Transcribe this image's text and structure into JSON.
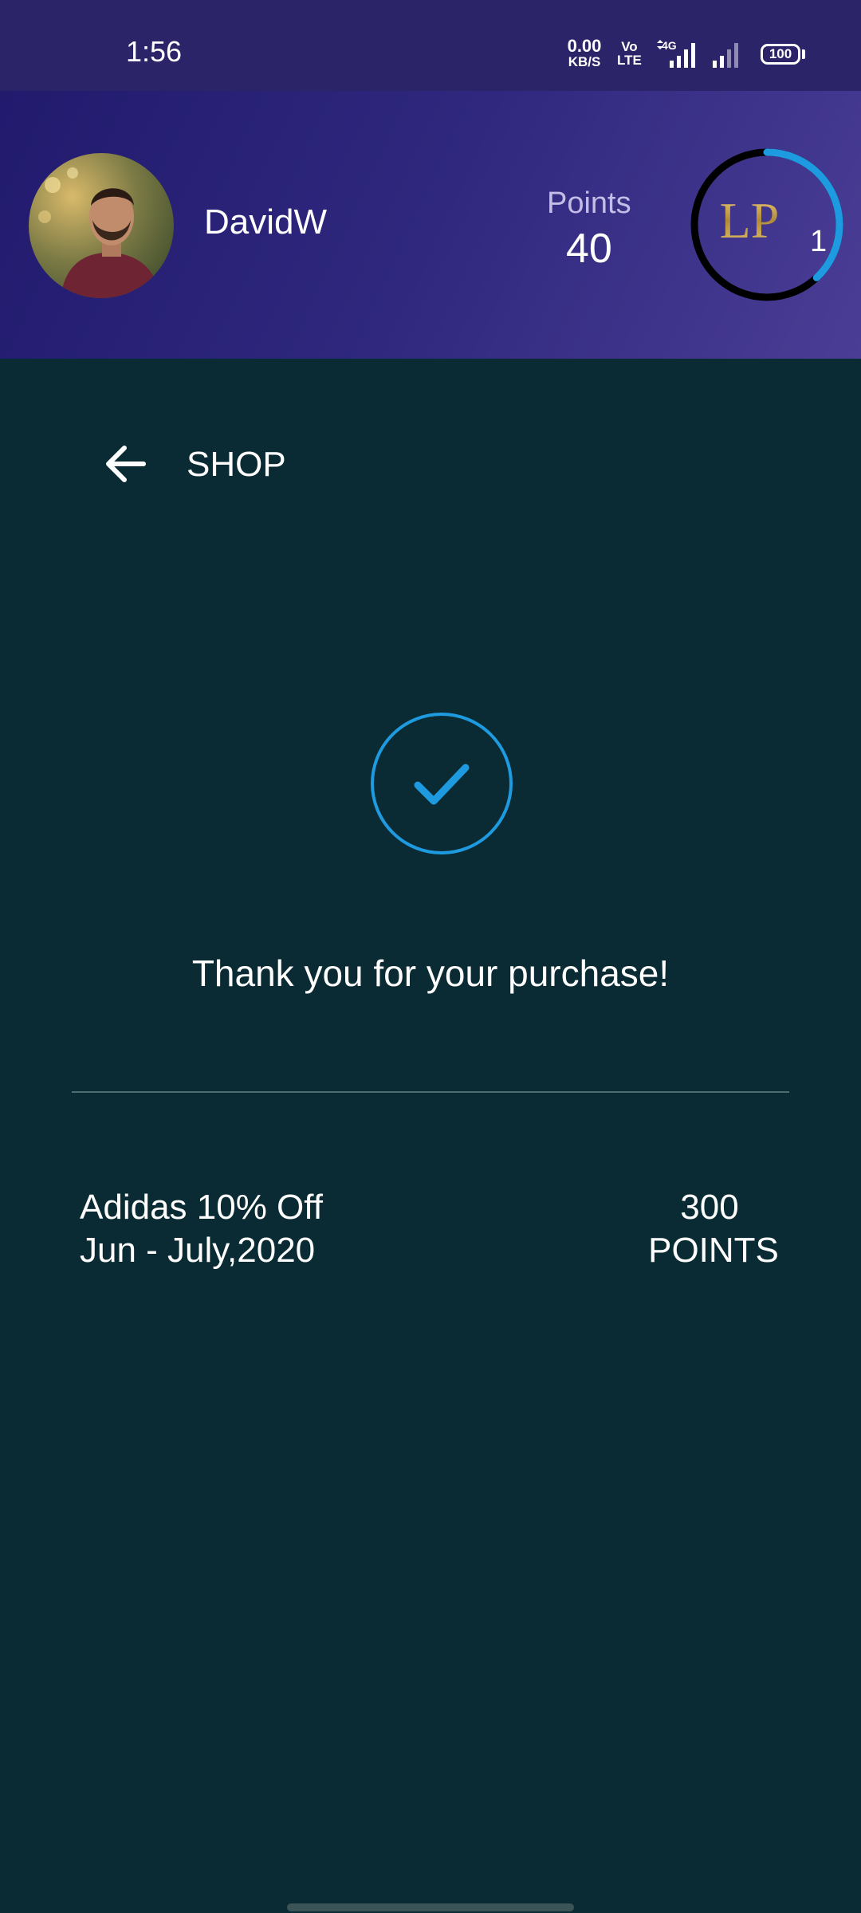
{
  "status_bar": {
    "time": "1:56",
    "net_speed": "0.00",
    "net_speed_unit": "KB/S",
    "volte_top": "Vo",
    "volte_bottom": "LTE",
    "network": "4G",
    "battery": "100"
  },
  "header": {
    "username": "DavidW",
    "points_label": "Points",
    "points_value": "40",
    "level_logo": "LP",
    "level_number": "1",
    "level_progress": 0.38
  },
  "nav": {
    "back_icon": "arrow-left-icon",
    "title": "SHOP"
  },
  "confirmation": {
    "icon": "check-circle-icon",
    "message": "Thank you for your purchase!"
  },
  "purchase": {
    "item_name": "Adidas 10% Off",
    "item_date": "Jun - July,2020",
    "cost_value": "300",
    "cost_unit": "POINTS"
  },
  "colors": {
    "accent": "#1e9be0",
    "background": "#0a2b33",
    "header_start": "#211a6d",
    "header_end": "#4a3d95"
  }
}
